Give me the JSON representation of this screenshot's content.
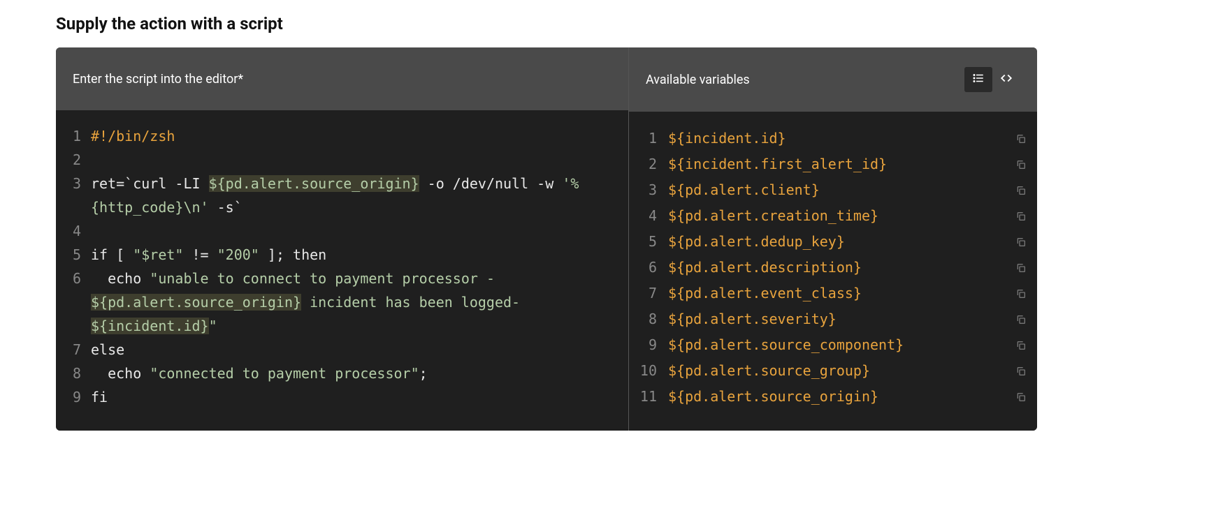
{
  "section_title": "Supply the action with a script",
  "editor": {
    "label": "Enter the script into the editor*",
    "lines": [
      {
        "n": "1",
        "tokens": [
          {
            "t": "#!/bin/zsh",
            "c": "c-comment"
          }
        ]
      },
      {
        "n": "2",
        "tokens": [
          {
            "t": "",
            "c": "c-plain"
          }
        ]
      },
      {
        "n": "3",
        "tokens": [
          {
            "t": "ret=`curl -LI ",
            "c": "c-plain"
          },
          {
            "t": "${pd.alert.source_origin}",
            "c": "c-var"
          },
          {
            "t": " -o /dev/null -w ",
            "c": "c-plain"
          },
          {
            "t": "'%{http_code}\\n'",
            "c": "c-str"
          },
          {
            "t": " -s`",
            "c": "c-plain"
          }
        ]
      },
      {
        "n": "4",
        "tokens": [
          {
            "t": "",
            "c": "c-plain"
          }
        ]
      },
      {
        "n": "5",
        "tokens": [
          {
            "t": "if [ ",
            "c": "c-plain"
          },
          {
            "t": "\"$ret\"",
            "c": "c-str"
          },
          {
            "t": " != ",
            "c": "c-plain"
          },
          {
            "t": "\"200\"",
            "c": "c-str"
          },
          {
            "t": " ]; then",
            "c": "c-plain"
          }
        ]
      },
      {
        "n": "6",
        "tokens": [
          {
            "t": "  echo ",
            "c": "c-plain"
          },
          {
            "t": "\"unable to connect to payment processor - ",
            "c": "c-str"
          },
          {
            "t": "${pd.alert.source_origin}",
            "c": "c-var"
          },
          {
            "t": " incident has been logged- ",
            "c": "c-str"
          },
          {
            "t": "${incident.id}",
            "c": "c-var"
          },
          {
            "t": "\"",
            "c": "c-str"
          }
        ]
      },
      {
        "n": "7",
        "tokens": [
          {
            "t": "else",
            "c": "c-plain"
          }
        ]
      },
      {
        "n": "8",
        "tokens": [
          {
            "t": "  echo ",
            "c": "c-plain"
          },
          {
            "t": "\"connected to payment processor\"",
            "c": "c-str"
          },
          {
            "t": ";",
            "c": "c-plain"
          }
        ]
      },
      {
        "n": "9",
        "tokens": [
          {
            "t": "fi",
            "c": "c-plain"
          }
        ]
      }
    ]
  },
  "variables": {
    "label": "Available variables",
    "items": [
      "${incident.id}",
      "${incident.first_alert_id}",
      "${pd.alert.client}",
      "${pd.alert.creation_time}",
      "${pd.alert.dedup_key}",
      "${pd.alert.description}",
      "${pd.alert.event_class}",
      "${pd.alert.severity}",
      "${pd.alert.source_component}",
      "${pd.alert.source_group}",
      "${pd.alert.source_origin}"
    ]
  }
}
